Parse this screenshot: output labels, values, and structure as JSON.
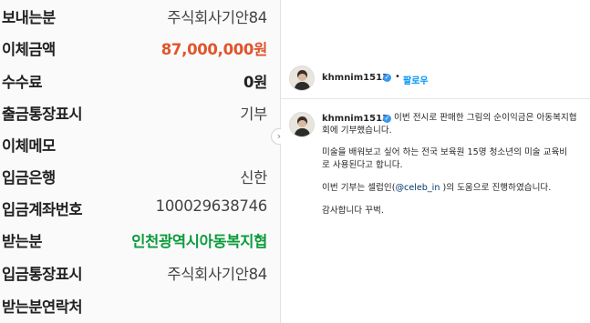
{
  "transfer": {
    "rows": [
      {
        "label": "보내는분",
        "value": "주식회사기안84",
        "style": ""
      },
      {
        "label": "이체금액",
        "value": "87,000,000원",
        "style": "orange"
      },
      {
        "label": "수수료",
        "value": "0원",
        "style": "boldblack"
      },
      {
        "label": "출금통장표시",
        "value": "기부",
        "style": ""
      },
      {
        "label": "이체메모",
        "value": "",
        "style": ""
      },
      {
        "label": "입금은행",
        "value": "신한",
        "style": ""
      },
      {
        "label": "입금계좌번호",
        "value": "100029638746",
        "style": ""
      },
      {
        "label": "받는분",
        "value": "인천광역시아동복지협",
        "style": "green"
      },
      {
        "label": "입금통장표시",
        "value": "주식회사기안84",
        "style": ""
      },
      {
        "label": "받는분연락처",
        "value": "",
        "style": ""
      }
    ]
  },
  "post": {
    "username": "khmnim1513",
    "follow_label": "팔로우",
    "dot": "•",
    "comment_lines": [
      "이번 전시로 판매한 그림의 순이익금은 아동복지협",
      "회에 기부했습니다.",
      "미술을 배워보고 싶어 하는 전국 보육원 15명 청소년의 미술 교육비",
      "로 사용된다고 합니다."
    ],
    "line5_pre": "이번 기부는 셀럽인(",
    "mention": "@celeb_in",
    "line5_post": " )의 도움으로 진행하였습니다.",
    "closing": "감사합니다 꾸벅."
  },
  "colors": {
    "amount": "#e0542b",
    "recipient": "#0c9b3c",
    "link": "#0095f6",
    "verified": "#3897f0"
  },
  "icons": {
    "verified": "verified-badge-icon",
    "nav": "chevron-right-icon"
  }
}
